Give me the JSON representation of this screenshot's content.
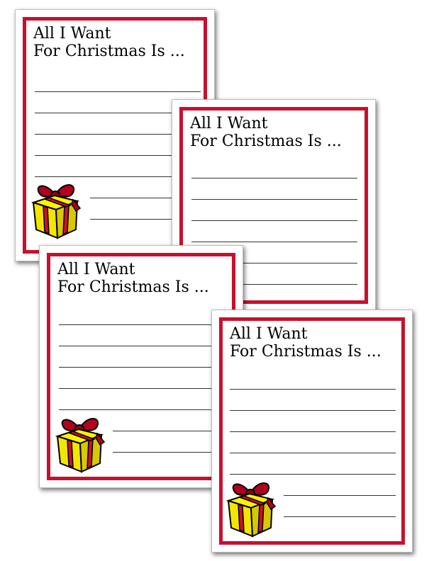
{
  "cards": [
    {
      "title_line1": "All I Want",
      "title_line2": "For Christmas Is ..."
    },
    {
      "title_line1": "All I Want",
      "title_line2": "For Christmas Is ..."
    },
    {
      "title_line1": "All I Want",
      "title_line2": "For Christmas Is ..."
    },
    {
      "title_line1": "All I Want",
      "title_line2": "For Christmas Is ..."
    }
  ],
  "colors": {
    "frame": "#c8102e",
    "gift_box": "#f2e600",
    "gift_ribbon": "#c8102e"
  },
  "icons": [
    "gift-icon"
  ]
}
